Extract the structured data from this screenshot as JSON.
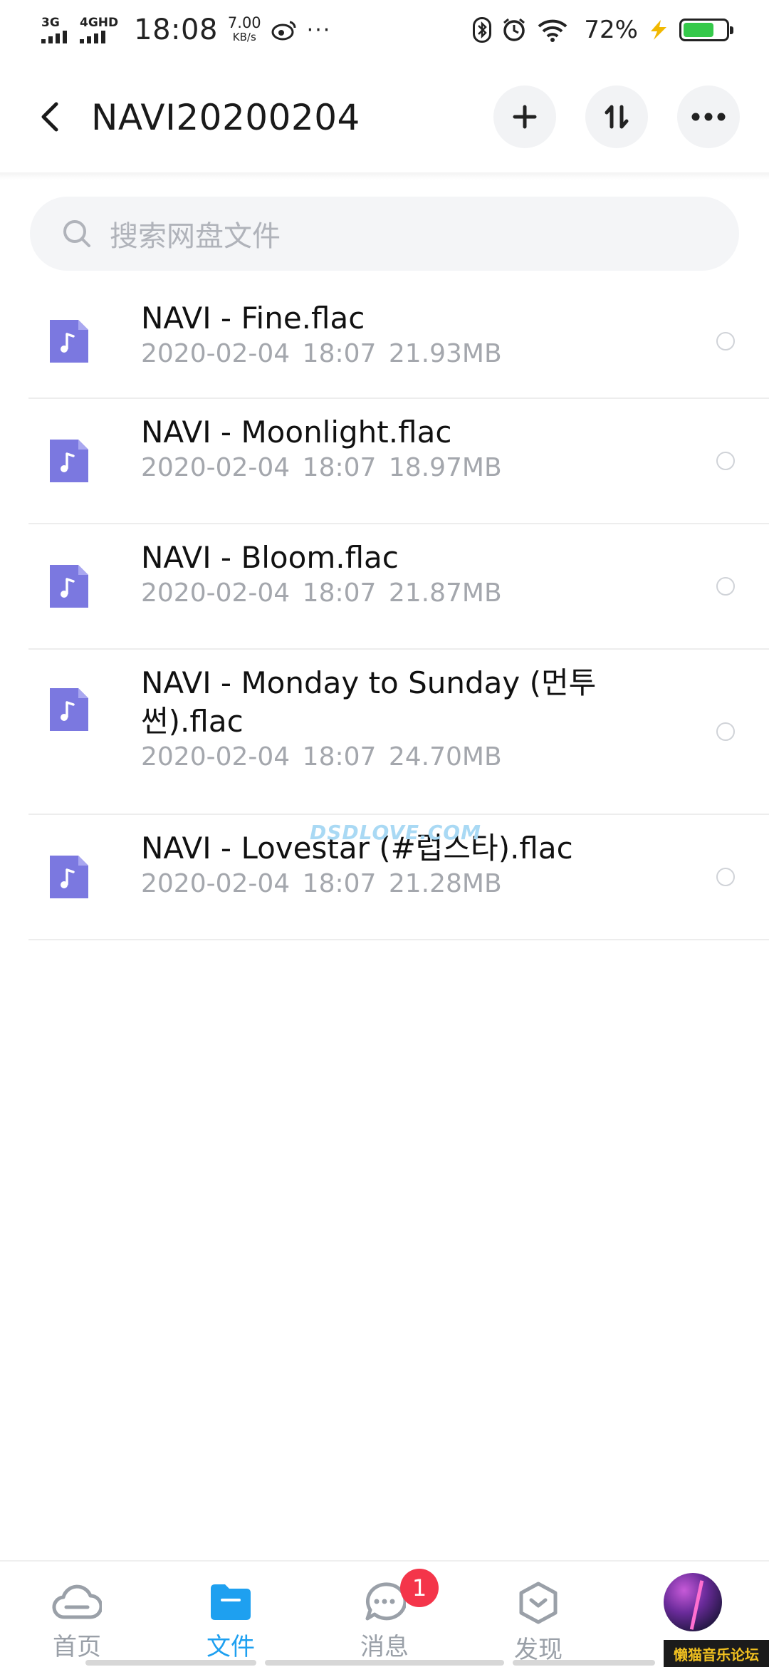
{
  "status_bar": {
    "signal1_label": "3G",
    "signal2_label": "4GHD",
    "time": "18:08",
    "speed_value": "7.00",
    "speed_unit": "KB/s",
    "more": "···",
    "battery_percent": "72%",
    "battery_level": 0.72,
    "battery_color": "#35c94a"
  },
  "header": {
    "title": "NAVI20200204",
    "back_icon": "chevron-left-icon",
    "add_icon": "plus-icon",
    "sort_icon": "sort-icon",
    "more_icon": "more-horizontal-icon"
  },
  "search": {
    "placeholder": "搜索网盘文件"
  },
  "files": [
    {
      "name": "NAVI - Fine.flac",
      "date": "2020-02-04",
      "time": "18:07",
      "size": "21.93MB"
    },
    {
      "name": "NAVI - Moonlight.flac",
      "date": "2020-02-04",
      "time": "18:07",
      "size": "18.97MB"
    },
    {
      "name": "NAVI - Bloom.flac",
      "date": "2020-02-04",
      "time": "18:07",
      "size": "21.87MB"
    },
    {
      "name": "NAVI - Monday to Sunday (먼투썬).flac",
      "date": "2020-02-04",
      "time": "18:07",
      "size": "24.70MB"
    },
    {
      "name": "NAVI - Lovestar (#럽스타).flac",
      "date": "2020-02-04",
      "time": "18:07",
      "size": "21.28MB"
    }
  ],
  "watermark": "DSDLOVE.COM",
  "bottom_nav": {
    "home": "首页",
    "files": "文件",
    "messages": "消息",
    "discover": "发现",
    "message_badge": "1",
    "active_color": "#1ea0f0"
  },
  "forum_badge": "懒猫音乐论坛"
}
